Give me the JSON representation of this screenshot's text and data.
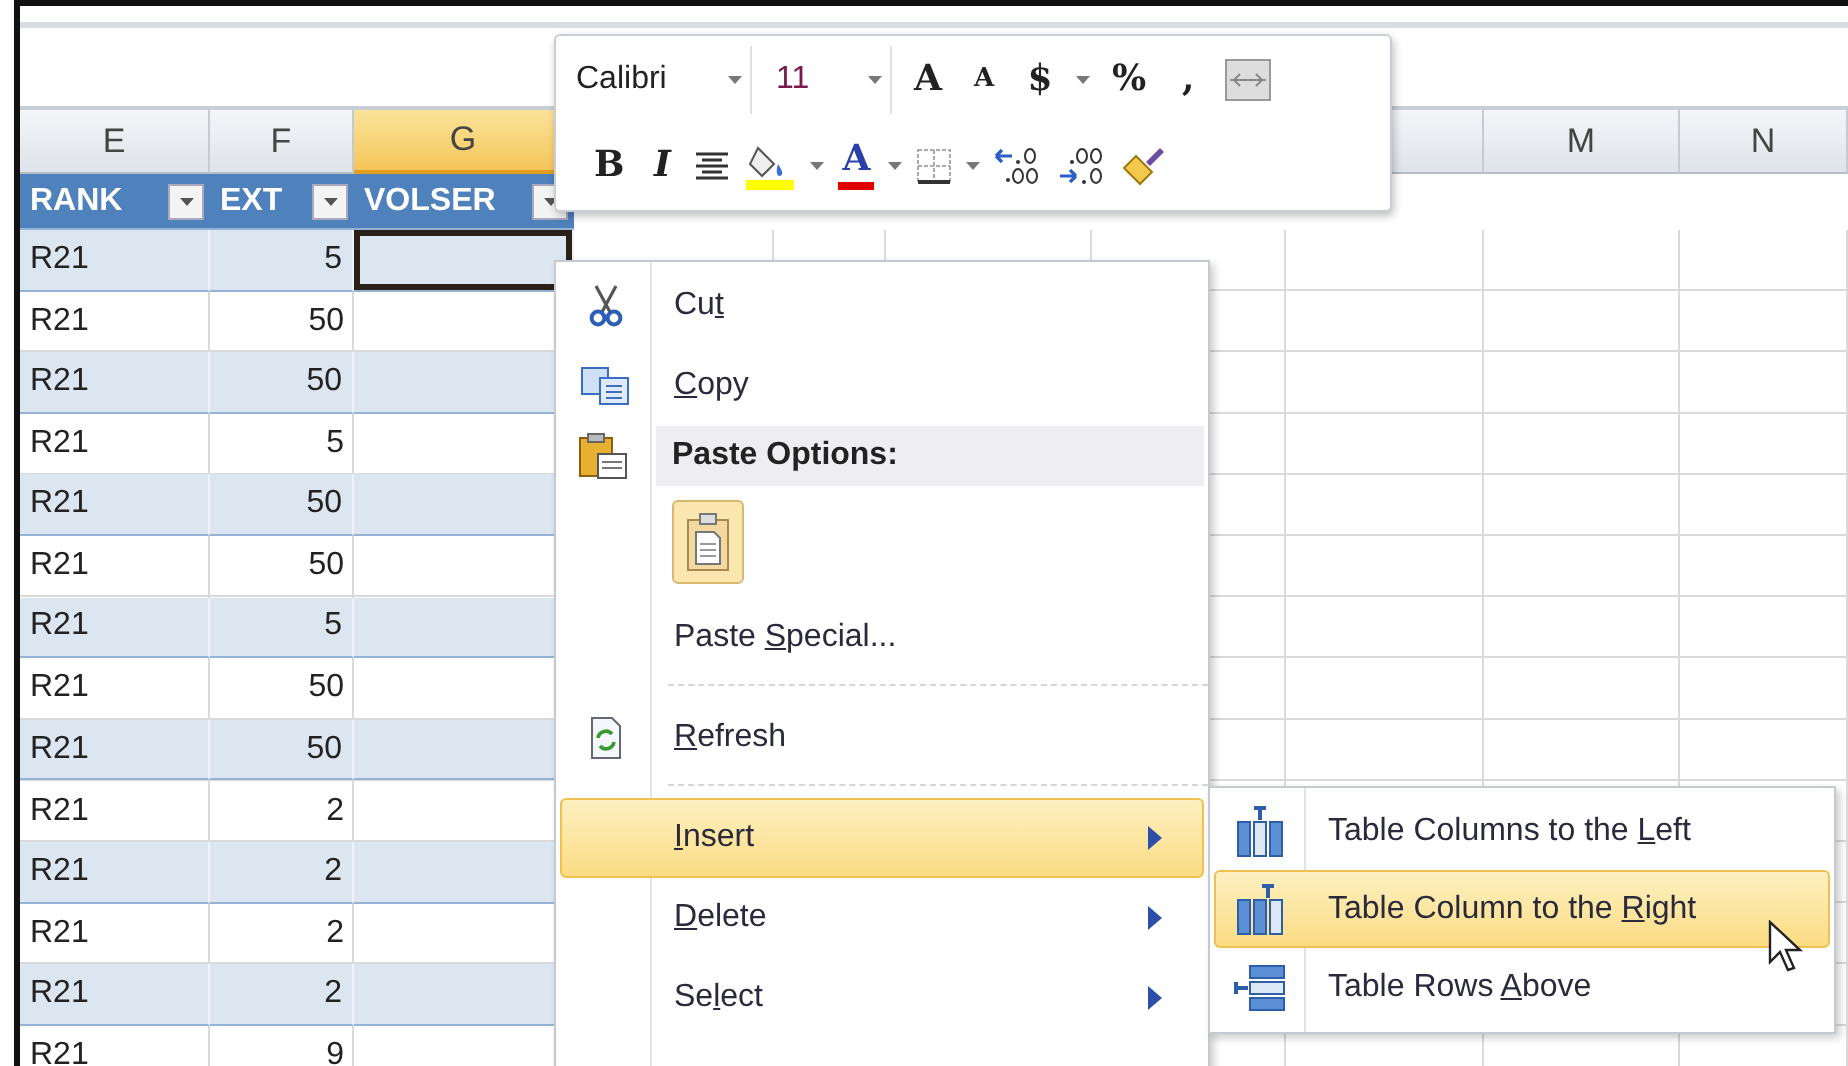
{
  "columns": [
    {
      "letter": "E",
      "selected": false
    },
    {
      "letter": "F",
      "selected": false
    },
    {
      "letter": "G",
      "selected": true
    },
    {
      "selected": false
    },
    {
      "letter": "M",
      "selected": false
    },
    {
      "letter": "N",
      "selected": false
    }
  ],
  "table_headers": [
    {
      "label": "RANK"
    },
    {
      "label": "EXT"
    },
    {
      "label": "VOLSER"
    }
  ],
  "rows": [
    {
      "rank": "R21",
      "ext": "5",
      "selected": true
    },
    {
      "rank": "R21",
      "ext": "50",
      "selected": false
    },
    {
      "rank": "R21",
      "ext": "50",
      "selected": false
    },
    {
      "rank": "R21",
      "ext": "5",
      "selected": false
    },
    {
      "rank": "R21",
      "ext": "50",
      "selected": false
    },
    {
      "rank": "R21",
      "ext": "50",
      "selected": false
    },
    {
      "rank": "R21",
      "ext": "5",
      "selected": false
    },
    {
      "rank": "R21",
      "ext": "50",
      "selected": false
    },
    {
      "rank": "R21",
      "ext": "50",
      "selected": false
    },
    {
      "rank": "R21",
      "ext": "2",
      "selected": false
    },
    {
      "rank": "R21",
      "ext": "2",
      "selected": false
    },
    {
      "rank": "R21",
      "ext": "2",
      "selected": false
    },
    {
      "rank": "R21",
      "ext": "2",
      "selected": false
    },
    {
      "rank": "R21",
      "ext": "9",
      "selected": false
    }
  ],
  "mini_toolbar": {
    "font": "Calibri",
    "size": "11",
    "row_1": [
      {
        "kind": "grow",
        "text": "A"
      },
      {
        "kind": "shrink",
        "text": "A"
      },
      {
        "kind": "glyph",
        "text": "$"
      },
      {
        "kind": "caret"
      },
      {
        "kind": "glyph",
        "text": "%"
      },
      {
        "kind": "glyph",
        "text": ","
      },
      {
        "kind": "merge"
      }
    ],
    "row_2": [
      {
        "kind": "bold",
        "text": "B"
      },
      {
        "kind": "italic",
        "text": "I"
      },
      {
        "kind": "center"
      },
      {
        "kind": "fill",
        "color": "#ffff00"
      },
      {
        "kind": "caret"
      },
      {
        "kind": "font-color",
        "text": "A",
        "color": "#e00000"
      },
      {
        "kind": "caret"
      },
      {
        "kind": "borders"
      },
      {
        "kind": "caret"
      },
      {
        "kind": "add-decimal"
      },
      {
        "kind": "remove-decimal"
      },
      {
        "kind": "painter"
      }
    ]
  },
  "context_menu": {
    "items": [
      {
        "kind": "cut",
        "label": {
          "pre": "Cu",
          "key": "t"
        },
        "selected": false
      },
      {
        "kind": "copy",
        "label": {
          "key": "C",
          "post": "opy"
        },
        "selected": false
      },
      {
        "kind": "header",
        "label": "Paste Options:"
      },
      {
        "kind": "paste-button"
      },
      {
        "kind": "plain",
        "label": {
          "pre": "Paste ",
          "key": "S",
          "post": "pecial..."
        },
        "selected": false
      },
      {
        "kind": "separator"
      },
      {
        "kind": "refresh",
        "label": {
          "key": "R",
          "post": "efresh"
        },
        "selected": false
      },
      {
        "kind": "separator"
      },
      {
        "kind": "branch",
        "label": {
          "key": "I",
          "post": "nsert"
        },
        "selected": true
      },
      {
        "kind": "branch",
        "label": {
          "key": "D",
          "post": "elete"
        },
        "selected": false
      },
      {
        "kind": "branch",
        "label": {
          "pre": "Se",
          "key": "l",
          "post": "ect"
        },
        "selected": false
      }
    ]
  },
  "submenu": {
    "items": [
      {
        "kind": "columns-left",
        "label": {
          "pre": "Table Columns to the ",
          "key": "L",
          "post": "eft"
        },
        "selected": false
      },
      {
        "kind": "column-right",
        "label": {
          "pre": "Table Column to the ",
          "key": "R",
          "post": "ight"
        },
        "selected": true
      },
      {
        "kind": "rows-above",
        "label": {
          "pre": "Table Rows ",
          "key": "A",
          "post": "bove"
        },
        "selected": false
      }
    ]
  }
}
